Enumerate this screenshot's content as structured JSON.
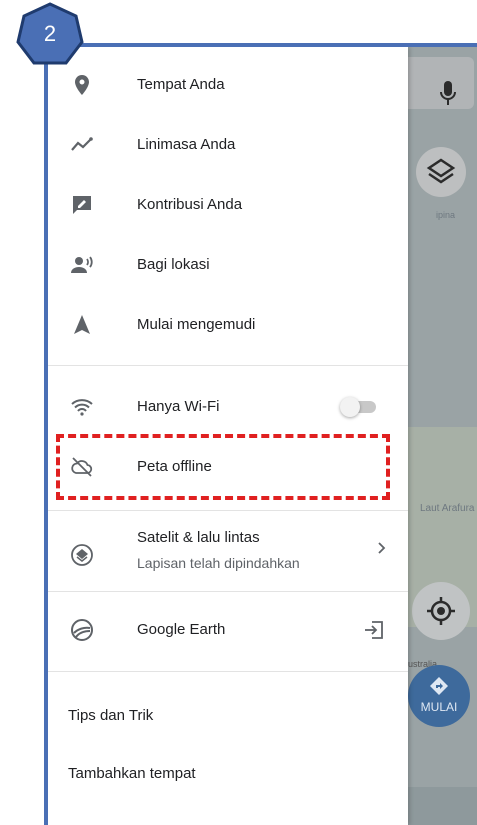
{
  "step_badge": {
    "number": "2",
    "fill": "#4a6fb5",
    "stroke": "#1f3b6e"
  },
  "menu": {
    "group1": [
      {
        "icon": "location-pin-icon",
        "label": "Tempat Anda"
      },
      {
        "icon": "timeline-icon",
        "label": "Linimasa Anda"
      },
      {
        "icon": "contribute-icon",
        "label": "Kontribusi Anda"
      },
      {
        "icon": "share-location-icon",
        "label": "Bagi lokasi"
      },
      {
        "icon": "navigation-arrow-icon",
        "label": "Mulai mengemudi"
      }
    ],
    "wifi": {
      "icon": "wifi-icon",
      "label": "Hanya Wi-Fi",
      "toggle_on": false
    },
    "offline": {
      "icon": "cloud-off-icon",
      "label": "Peta offline"
    },
    "satellite": {
      "icon": "layers-icon",
      "label": "Satelit & lalu lintas",
      "sublabel": "Lapisan telah dipindahkan"
    },
    "earth": {
      "icon": "google-earth-icon",
      "label": "Google Earth"
    },
    "tips": "Tips dan Trik",
    "add_place": "Tambahkan tempat"
  },
  "map": {
    "sea_label": "Laut Arafura",
    "small_label": "ipina",
    "au_label": "ustralia",
    "start_button": "MULAI"
  },
  "colors": {
    "frame": "#4a6fb5",
    "highlight": "#e02020"
  }
}
